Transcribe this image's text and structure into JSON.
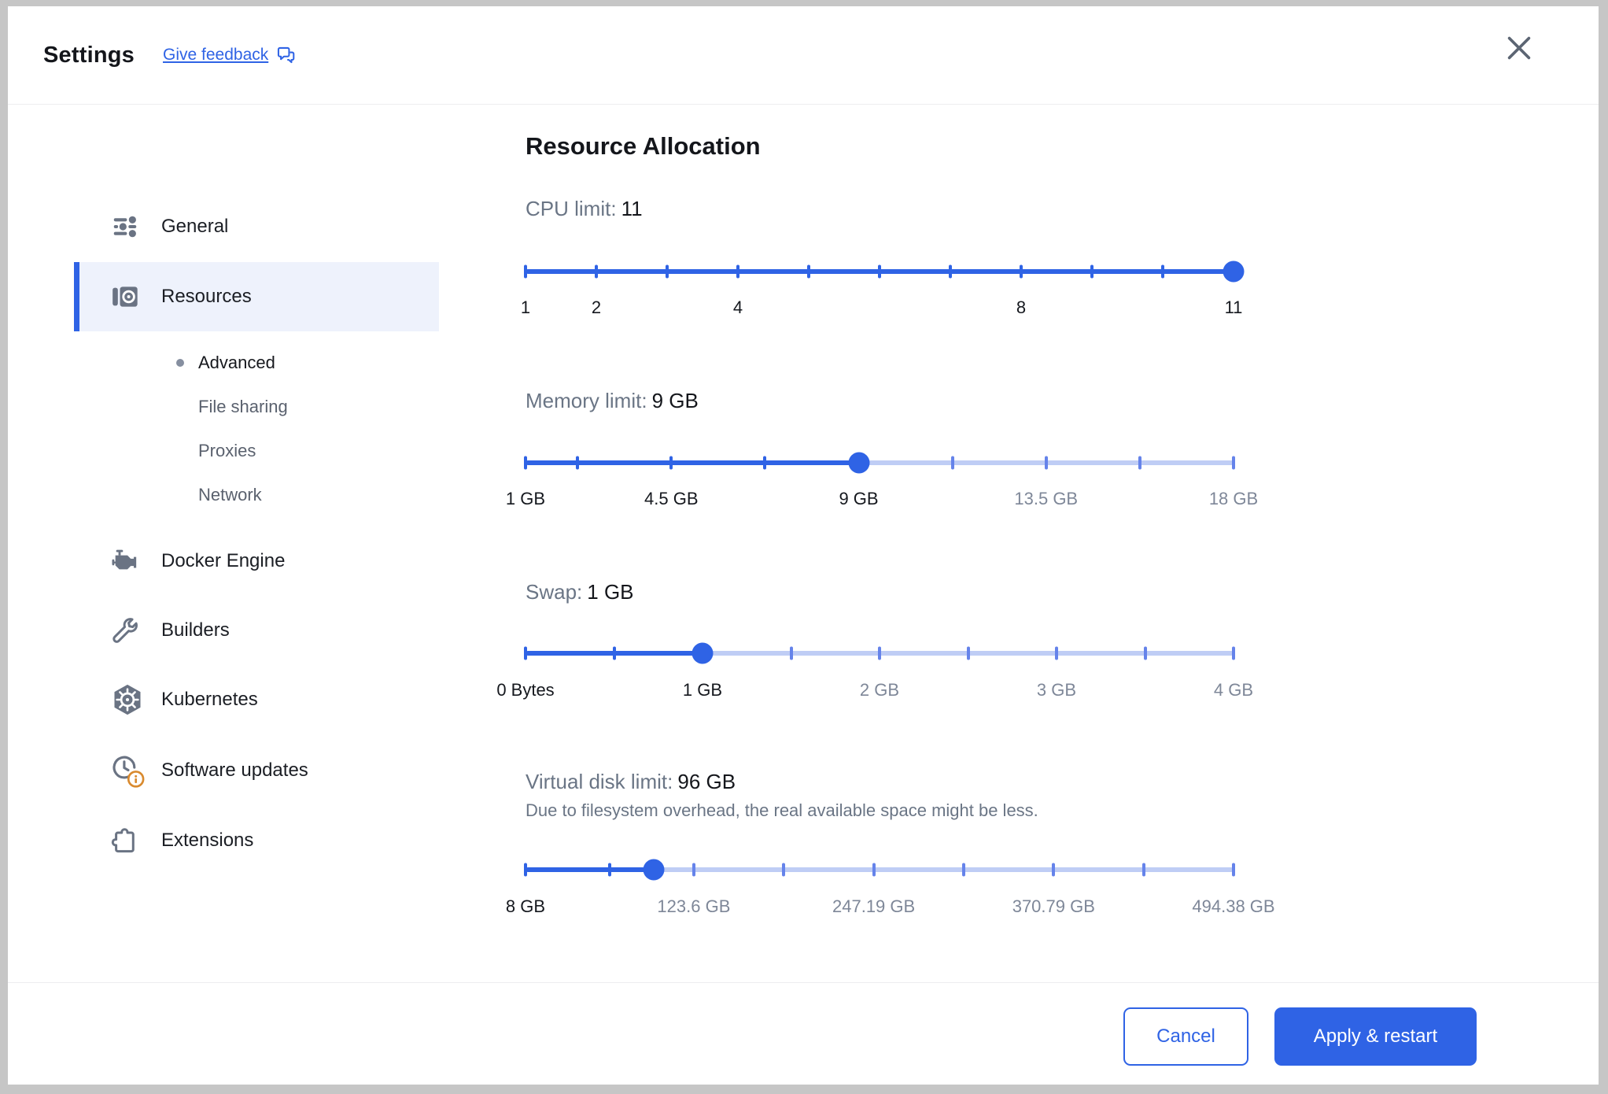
{
  "header": {
    "title": "Settings",
    "feedback_label": "Give feedback"
  },
  "sidebar": {
    "items": [
      {
        "label": "General",
        "icon": "sliders-icon"
      },
      {
        "label": "Resources",
        "icon": "resources-meter-icon",
        "selected": true
      },
      {
        "label": "Docker Engine",
        "icon": "engine-icon"
      },
      {
        "label": "Builders",
        "icon": "wrench-icon"
      },
      {
        "label": "Kubernetes",
        "icon": "kubernetes-helm-icon"
      },
      {
        "label": "Software updates",
        "icon": "update-clock-icon",
        "badge": "info"
      },
      {
        "label": "Extensions",
        "icon": "puzzle-icon"
      }
    ],
    "resources_children": [
      "Advanced",
      "File sharing",
      "Proxies",
      "Network"
    ],
    "active_child": "Advanced"
  },
  "resource_allocation": {
    "heading": "Resource Allocation",
    "sliders": [
      {
        "id": "cpu",
        "label": "CPU limit:",
        "value_text": "11",
        "min": 1,
        "max": 11,
        "value": 11,
        "tick_values": [
          1,
          2,
          3,
          4,
          5,
          6,
          7,
          8,
          9,
          10,
          11
        ],
        "labels": [
          {
            "text": "1",
            "value": 1,
            "active": true
          },
          {
            "text": "2",
            "value": 2,
            "active": true
          },
          {
            "text": "4",
            "value": 4,
            "active": true
          },
          {
            "text": "8",
            "value": 8,
            "active": true
          },
          {
            "text": "11",
            "value": 11,
            "active": true
          }
        ]
      },
      {
        "id": "memory",
        "label": "Memory limit:",
        "value_text": "9 GB",
        "min": 1,
        "max": 18,
        "value": 9,
        "tick_values": [
          1,
          2.25,
          4.5,
          6.75,
          9,
          11.25,
          13.5,
          15.75,
          18
        ],
        "labels": [
          {
            "text": "1 GB",
            "value": 1,
            "active": true
          },
          {
            "text": "4.5 GB",
            "value": 4.5,
            "active": true
          },
          {
            "text": "9 GB",
            "value": 9,
            "active": true
          },
          {
            "text": "13.5 GB",
            "value": 13.5,
            "active": false
          },
          {
            "text": "18 GB",
            "value": 18,
            "active": false
          }
        ]
      },
      {
        "id": "swap",
        "label": "Swap:",
        "value_text": "1 GB",
        "min": 0,
        "max": 4,
        "value": 1,
        "tick_values": [
          0,
          0.5,
          1,
          1.5,
          2,
          2.5,
          3,
          3.5,
          4
        ],
        "labels": [
          {
            "text": "0 Bytes",
            "value": 0,
            "active": true
          },
          {
            "text": "1 GB",
            "value": 1,
            "active": true
          },
          {
            "text": "2 GB",
            "value": 2,
            "active": false
          },
          {
            "text": "3 GB",
            "value": 3,
            "active": false
          },
          {
            "text": "4 GB",
            "value": 4,
            "active": false
          }
        ]
      },
      {
        "id": "disk",
        "label": "Virtual disk limit:",
        "value_text": "96 GB",
        "note": "Due to filesystem overhead, the real available space might be less.",
        "min": 8,
        "max": 494.38,
        "value": 96,
        "tick_values": [
          8,
          65.8,
          123.6,
          185.4,
          247.19,
          309,
          370.79,
          432.59,
          494.38
        ],
        "labels": [
          {
            "text": "8 GB",
            "value": 8,
            "active": true
          },
          {
            "text": "123.6 GB",
            "value": 123.6,
            "active": false
          },
          {
            "text": "247.19 GB",
            "value": 247.19,
            "active": false
          },
          {
            "text": "370.79 GB",
            "value": 370.79,
            "active": false
          },
          {
            "text": "494.38 GB",
            "value": 494.38,
            "active": false
          }
        ]
      }
    ]
  },
  "footer": {
    "cancel_label": "Cancel",
    "apply_label": "Apply & restart"
  },
  "colors": {
    "accent": "#2F63E5",
    "rail": "#BFCDF5",
    "tickoff": "#6583EA",
    "sel": "#EEF2FC",
    "icon": "#6A7383",
    "gray": "#6A7585",
    "gray2": "#7E8798",
    "badge_orange": "#D98A2E"
  }
}
